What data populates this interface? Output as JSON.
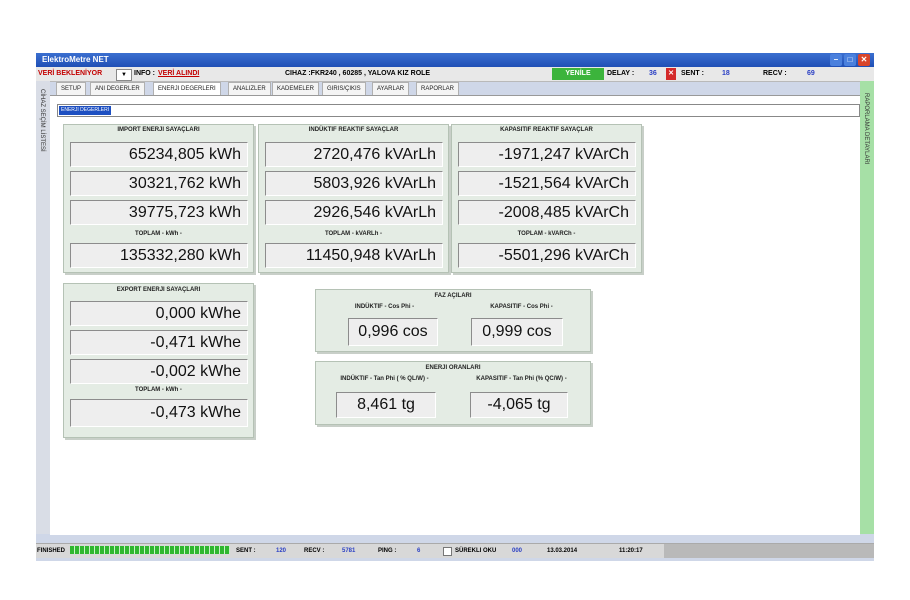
{
  "app": {
    "title": "ElektroMetre NET"
  },
  "toolbar": {
    "status": "VERİ BEKLENİYOR",
    "info_label": "INFO :",
    "info_value": "VERİ ALINDI",
    "device": "CIHAZ :FKR240 , 60285 , YALOVA KIZ ROLE",
    "refresh_label": "YENİLE",
    "delay_label": "DELAY :",
    "delay_value": "36",
    "sent_label": "SENT :",
    "sent_value": "18",
    "recv_label": "RECV :",
    "recv_value": "69"
  },
  "tabs": [
    "SETUP",
    "ANI DEGERLER",
    "ENERJI DEGERLERI",
    "ANALIZLER",
    "KADEMELER",
    "GIRIS/ÇIKIS",
    "AYARLAR",
    "RAPORLAR"
  ],
  "sidebar": {
    "left_label": "CİHAZ SEÇİM LİSTESİ",
    "right_label": "RAPORLAMA DETAYLARI"
  },
  "section_label": "ENERJI DEGERLERI",
  "import": {
    "title": "IMPORT ENERJI SAYAÇLARI",
    "values": [
      "65234,805 kWh",
      "30321,762 kWh",
      "39775,723 kWh"
    ],
    "total_label": "TOPLAM - kWh -",
    "total": "135332,280 kWh"
  },
  "inductive": {
    "title": "INDÜKTIF REAKTIF SAYAÇLAR",
    "values": [
      "2720,476 kVArLh",
      "5803,926 kVArLh",
      "2926,546 kVArLh"
    ],
    "total_label": "TOPLAM - kVARLh -",
    "total": "11450,948 kVArLh"
  },
  "capacitive": {
    "title": "KAPASITIF REAKTIF SAYAÇLAR",
    "values": [
      "-1971,247 kVArCh",
      "-1521,564 kVArCh",
      "-2008,485 kVArCh"
    ],
    "total_label": "TOPLAM - kVARCh -",
    "total": "-5501,296 kVArCh"
  },
  "export": {
    "title": "EXPORT ENERJI SAYAÇLARI",
    "values": [
      "0,000 kWhe",
      "-0,471 kWhe",
      "-0,002 kWhe"
    ],
    "total_label": "TOPLAM - kWh -",
    "total": "-0,473 kWhe"
  },
  "phase": {
    "title": "FAZ AÇILARI",
    "ind_label": "INDÜKTIF - Cos Phi -",
    "cap_label": "KAPASITIF - Cos Phi -",
    "ind_value": "0,996 cos",
    "cap_value": "0,999 cos"
  },
  "ratio": {
    "title": "ENERJI ORANLARI",
    "ind_label": "INDÜKTIF - Tan Phi ( % QL/W) -",
    "cap_label": "KAPASITIF - Tan Phi (% QC/W) -",
    "ind_value": "8,461 tg",
    "cap_value": "-4,065 tg"
  },
  "statusbar": {
    "finished": "FINISHED",
    "sent_label": "SENT :",
    "sent_value": "120",
    "recv_label": "RECV :",
    "recv_value": "5781",
    "ping_label": "PING :",
    "ping_value": "6",
    "continuous_label": "SÜREKLI OKU",
    "continuous_value": "000",
    "date": "13.03.2014",
    "time": "11:20:17"
  },
  "colors": {
    "accent": "#1f4fb5",
    "refresh": "#3cb43c",
    "danger": "#d42a2a",
    "status_text": "#c40000"
  },
  "icons": [
    "app-icon",
    "minimize-icon",
    "maximize-icon",
    "close-icon"
  ]
}
